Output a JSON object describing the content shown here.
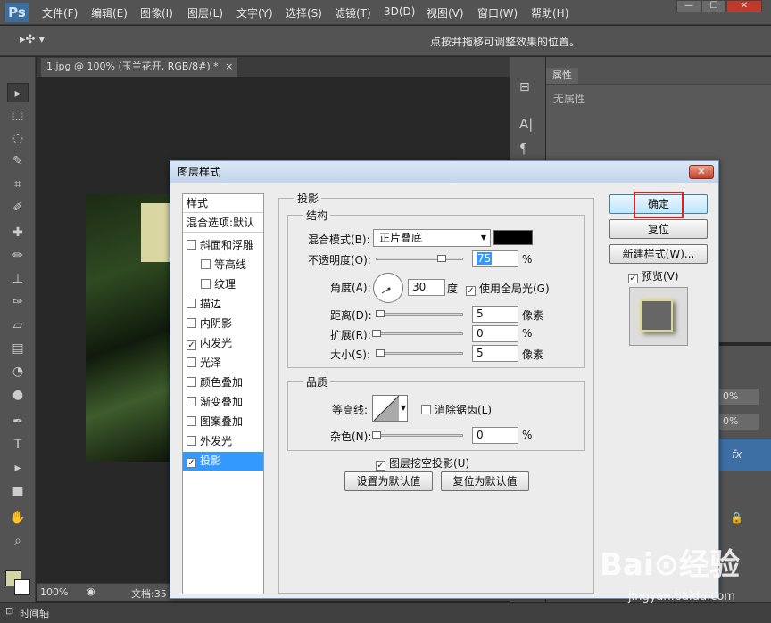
{
  "app": {
    "logo": "Ps"
  },
  "menu": [
    "文件(F)",
    "编辑(E)",
    "图像(I)",
    "图层(L)",
    "文字(Y)",
    "选择(S)",
    "滤镜(T)",
    "3D(D)",
    "视图(V)",
    "窗口(W)",
    "帮助(H)"
  ],
  "window_controls": {
    "minimize": "—",
    "restore": "☐",
    "close": "✕"
  },
  "options_bar": {
    "hint": "点按并拖移可调整效果的位置。"
  },
  "document": {
    "tab_label": "1.jpg @ 100% (玉兰花开, RGB/8#) *",
    "tab_close": "×",
    "zoom": "100%",
    "doc_info": "文档:35"
  },
  "timeline": {
    "label": "时间轴"
  },
  "properties_panel": {
    "tab": "属性",
    "empty_text": "无属性"
  },
  "layers_panel": {
    "opacity_1": "0%",
    "opacity_2": "0%",
    "fx": "fx"
  },
  "dialog": {
    "title": "图层样式",
    "close": "✕",
    "styles_header": "样式",
    "blend_options": "混合选项:默认",
    "style_items": [
      {
        "label": "斜面和浮雕",
        "checked": false
      },
      {
        "label": "等高线",
        "checked": false
      },
      {
        "label": "纹理",
        "checked": false
      },
      {
        "label": "描边",
        "checked": false
      },
      {
        "label": "内阴影",
        "checked": false
      },
      {
        "label": "内发光",
        "checked": true
      },
      {
        "label": "光泽",
        "checked": false
      },
      {
        "label": "颜色叠加",
        "checked": false
      },
      {
        "label": "渐变叠加",
        "checked": false
      },
      {
        "label": "图案叠加",
        "checked": false
      },
      {
        "label": "外发光",
        "checked": false
      },
      {
        "label": "投影",
        "checked": true
      }
    ],
    "section_title": "投影",
    "structure_title": "结构",
    "blend_mode_label": "混合模式(B):",
    "blend_mode_value": "正片叠底",
    "shadow_color": "#000000",
    "opacity_label": "不透明度(O):",
    "opacity_value": "75",
    "percent": "%",
    "angle_label": "角度(A):",
    "angle_value": "30",
    "degree": "度",
    "global_light": "使用全局光(G)",
    "global_light_checked": true,
    "distance_label": "距离(D):",
    "distance_value": "5",
    "pixels": "像素",
    "spread_label": "扩展(R):",
    "spread_value": "0",
    "size_label": "大小(S):",
    "size_value": "5",
    "quality_title": "品质",
    "contour_label": "等高线:",
    "anti_alias": "消除锯齿(L)",
    "anti_alias_checked": false,
    "noise_label": "杂色(N):",
    "noise_value": "0",
    "knockout": "图层挖空投影(U)",
    "knockout_checked": true,
    "set_default": "设置为默认值",
    "reset_default": "复位为默认值",
    "ok": "确定",
    "reset": "复位",
    "new_style": "新建样式(W)...",
    "preview": "预览(V)",
    "preview_checked": true
  },
  "watermark": {
    "main": "Bai⊙经验",
    "sub": "jingyan.baidu.com"
  }
}
